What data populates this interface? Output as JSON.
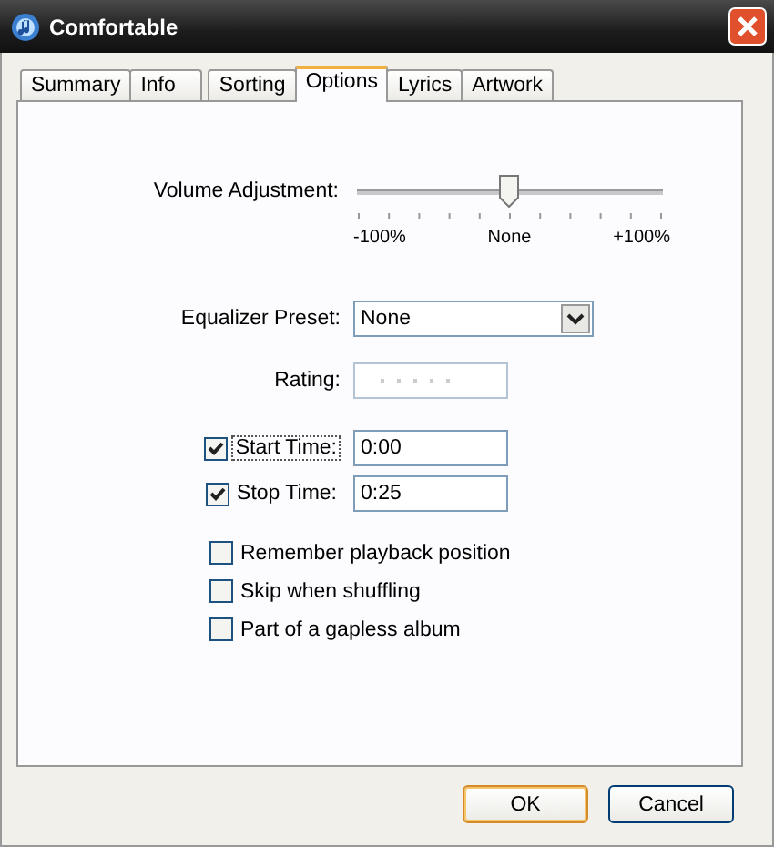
{
  "window": {
    "title": "Comfortable"
  },
  "tabs": [
    {
      "label": "Summary",
      "selected": false
    },
    {
      "label": "Info",
      "selected": false
    },
    {
      "label": "Sorting",
      "selected": false
    },
    {
      "label": "Options",
      "selected": true
    },
    {
      "label": "Lyrics",
      "selected": false
    },
    {
      "label": "Artwork",
      "selected": false
    }
  ],
  "volume": {
    "label": "Volume Adjustment:",
    "level": 0.5,
    "min_label": "-100%",
    "mid_label": "None",
    "max_label": "+100%"
  },
  "equalizer": {
    "label": "Equalizer Preset:",
    "value": "None"
  },
  "rating": {
    "label": "Rating:"
  },
  "times": [
    {
      "label": "Start Time:",
      "checked": true,
      "focused": true,
      "value": "0:00"
    },
    {
      "label": "Stop Time:",
      "checked": true,
      "focused": false,
      "value": "0:25"
    }
  ],
  "options": [
    {
      "label": "Remember playback position",
      "checked": false
    },
    {
      "label": "Skip when shuffling",
      "checked": false
    },
    {
      "label": "Part of a gapless album",
      "checked": false
    }
  ],
  "buttons": [
    {
      "label": "OK",
      "default": true
    },
    {
      "label": "Cancel",
      "default": false
    }
  ]
}
